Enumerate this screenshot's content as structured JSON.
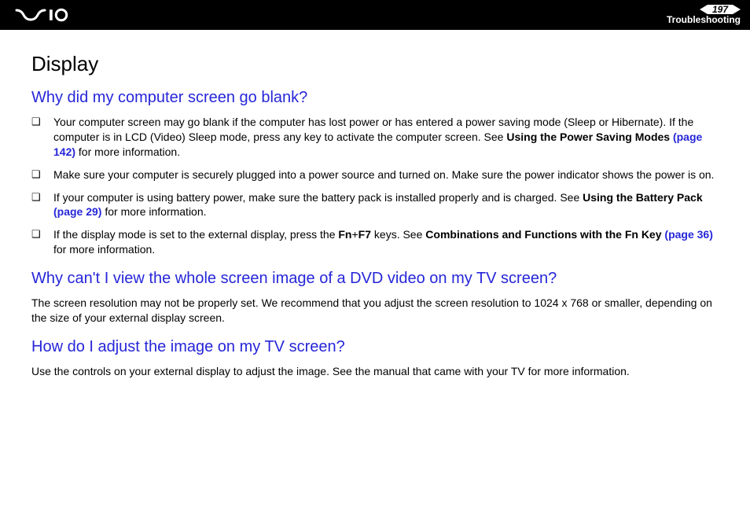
{
  "header": {
    "page_number": "197",
    "section": "Troubleshooting"
  },
  "content": {
    "title": "Display",
    "q1": {
      "heading": "Why did my computer screen go blank?",
      "b1": {
        "pre": "Your computer screen may go blank if the computer has lost power or has entered a power saving mode (Sleep or Hibernate). If the computer is in LCD (Video) Sleep mode, press any key to activate the computer screen. See ",
        "bold": "Using the Power Saving Modes ",
        "link": "(page 142)",
        "post": " for more information."
      },
      "b2": "Make sure your computer is securely plugged into a power source and turned on. Make sure the power indicator shows the power is on.",
      "b3": {
        "pre": "If your computer is using battery power, make sure the battery pack is installed properly and is charged. See ",
        "bold": "Using the Battery Pack ",
        "link": "(page 29)",
        "post": " for more information."
      },
      "b4": {
        "pre": "If the display mode is set to the external display, press the ",
        "key1": "Fn",
        "plus": "+",
        "key2": "F7",
        "mid": " keys. See ",
        "bold": "Combinations and Functions with the Fn Key ",
        "link": "(page 36)",
        "post": " for more information."
      }
    },
    "q2": {
      "heading": "Why can't I view the whole screen image of a DVD video on my TV screen?",
      "body": "The screen resolution may not be properly set. We recommend that you adjust the screen resolution to 1024 x 768 or smaller, depending on the size of your external display screen."
    },
    "q3": {
      "heading": "How do I adjust the image on my TV screen?",
      "body": "Use the controls on your external display to adjust the image. See the manual that came with your TV for more information."
    }
  }
}
